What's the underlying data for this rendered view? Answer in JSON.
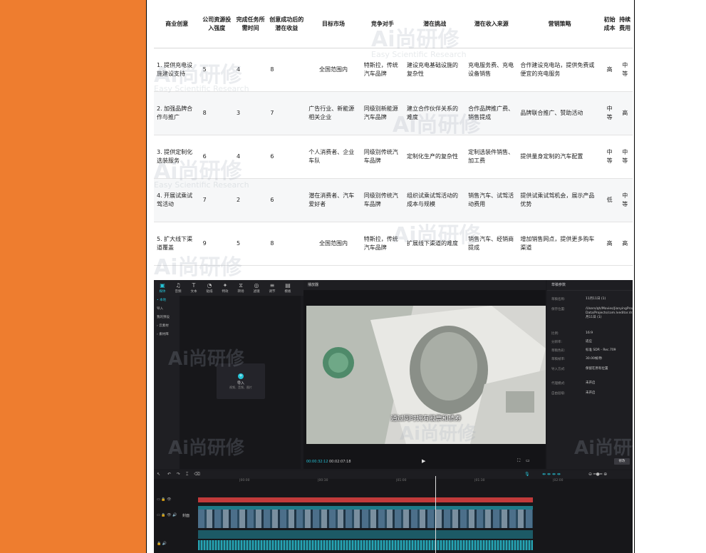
{
  "table": {
    "headers": [
      "商业创意",
      "公司资源投入强度",
      "完成任务所需时间",
      "创意成功后的潜在收益",
      "目标市场",
      "竞争对手",
      "潜在挑战",
      "潜在收入来源",
      "营销策略",
      "初始成本",
      "持续费用"
    ],
    "rows": [
      [
        "1. 提供充电设施建设支持",
        "5",
        "4",
        "8",
        "全国范围内",
        "特斯拉，传统汽车品牌",
        "建设充电基础设施的复杂性",
        "充电服务费、充电设备销售",
        "合作建设充电站，提供免费或便宜的充电服务",
        "高",
        "中等"
      ],
      [
        "2. 加强品牌合作与推广",
        "8",
        "3",
        "7",
        "广告行业、新能源相关企业",
        "同级别新能源汽车品牌",
        "建立合作伙伴关系的难度",
        "合作品牌推广费、销售提成",
        "品牌联合推广、赞助活动",
        "中等",
        "高"
      ],
      [
        "3. 提供定制化选装服务",
        "6",
        "4",
        "6",
        "个人消费者、企业车队",
        "同级别传统汽车品牌",
        "定制化生产的复杂性",
        "定制选装件销售、加工费",
        "提供量身定制的汽车配置",
        "中等",
        "中等"
      ],
      [
        "4. 开展试乘试驾活动",
        "7",
        "2",
        "6",
        "潜在消费者、汽车爱好者",
        "同级别传统汽车品牌",
        "组织试乘试驾活动的成本与规模",
        "销售汽车、试驾活动费用",
        "提供试乘试驾机会，展示产品优势",
        "低",
        "中等"
      ],
      [
        "5. 扩大线下渠道覆盖",
        "9",
        "5",
        "8",
        "全国范围内",
        "特斯拉，传统汽车品牌",
        "扩展线下渠道的难度",
        "销售汽车、经销商提成",
        "增加销售网点，提供更多购车渠道",
        "高",
        "高"
      ]
    ]
  },
  "watermark": {
    "main": "Ai尚研修",
    "sub": "Easy Scientific Research"
  },
  "editor": {
    "toolbar": [
      {
        "icon": "▣",
        "label": "媒体"
      },
      {
        "icon": "♫",
        "label": "音频"
      },
      {
        "icon": "T",
        "label": "文本"
      },
      {
        "icon": "◔",
        "label": "贴纸"
      },
      {
        "icon": "✦",
        "label": "特效"
      },
      {
        "icon": "⧖",
        "label": "转场"
      },
      {
        "icon": "◎",
        "label": "滤镜"
      },
      {
        "icon": "≡",
        "label": "调节"
      },
      {
        "icon": "▤",
        "label": "模板"
      }
    ],
    "side_items": [
      "• 本地",
      "导入",
      "我的预设",
      "› 云素材",
      "› 素材库"
    ],
    "import_label": "导入",
    "import_hint": "视频、音频、图片",
    "player_title": "播放器",
    "subtitle": "通过同时拥有股票和债券",
    "time_current": "00:00:32:12",
    "time_total": "00:02:07:18",
    "props_title": "草稿参数",
    "props": [
      {
        "k": "草稿名称:",
        "v": "11月11日 (1)"
      },
      {
        "k": "保存位置:",
        "v": "/Users/qh/Movies/JianyingPro/User Data/Projects/com.lveditor.draft/11月11日 (1)"
      },
      {
        "k": "比例:",
        "v": "16:9"
      },
      {
        "k": "分辨率:",
        "v": "适应"
      },
      {
        "k": "草稿色彩:",
        "v": "标准 SDR - Rec.709"
      },
      {
        "k": "草稿帧率:",
        "v": "30.00帧/秒"
      },
      {
        "k": "导入方式:",
        "v": "保留在原有位置"
      },
      {
        "k": "代理模式:",
        "v": "未开启"
      },
      {
        "k": "自由层级:",
        "v": "未开启"
      }
    ],
    "modify_label": "修改",
    "cover_label": "封面",
    "ruler_ticks": [
      "|00:00",
      "|00:30",
      "|01:00",
      "|01:30",
      "|02:00"
    ]
  }
}
